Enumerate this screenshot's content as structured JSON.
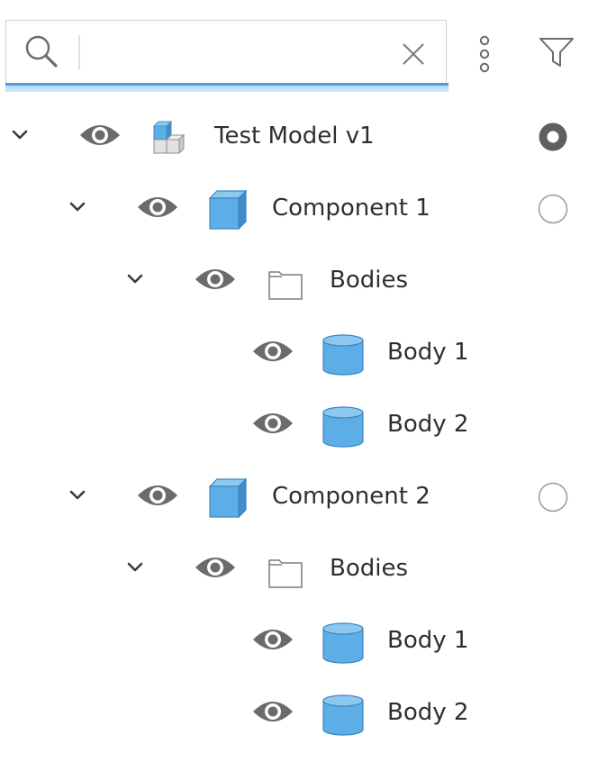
{
  "search": {
    "value": "",
    "placeholder": ""
  },
  "colors": {
    "accent": "#4d9bd8",
    "icon_blue": "#5daee6",
    "icon_gray": "#6b6b6b"
  },
  "toolbar_icons": [
    "search-icon",
    "close-icon",
    "more-vertical-icon",
    "filter-icon"
  ],
  "tree": [
    {
      "label": "Test Model v1",
      "type": "model",
      "icon": "assembly-icon",
      "level": 0,
      "expanded": true,
      "visible": true,
      "activation": "active"
    },
    {
      "label": "Component 1",
      "type": "component",
      "icon": "component-cube-icon",
      "level": 1,
      "expanded": true,
      "visible": true,
      "activation": "inactive"
    },
    {
      "label": "Bodies",
      "type": "folder",
      "icon": "folder-icon",
      "level": 2,
      "expanded": true,
      "visible": true,
      "activation": "none"
    },
    {
      "label": "Body 1",
      "type": "body",
      "icon": "body-cylinder-icon",
      "level": 3,
      "expanded": false,
      "visible": true,
      "activation": "none"
    },
    {
      "label": "Body 2",
      "type": "body",
      "icon": "body-cylinder-icon",
      "level": 3,
      "expanded": false,
      "visible": true,
      "activation": "none"
    },
    {
      "label": "Component 2",
      "type": "component",
      "icon": "component-cube-icon",
      "level": 1,
      "expanded": true,
      "visible": true,
      "activation": "inactive"
    },
    {
      "label": "Bodies",
      "type": "folder",
      "icon": "folder-icon",
      "level": 2,
      "expanded": true,
      "visible": true,
      "activation": "none"
    },
    {
      "label": "Body 1",
      "type": "body",
      "icon": "body-cylinder-icon",
      "level": 3,
      "expanded": false,
      "visible": true,
      "activation": "none"
    },
    {
      "label": "Body 2",
      "type": "body",
      "icon": "body-cylinder-icon",
      "level": 3,
      "expanded": false,
      "visible": true,
      "activation": "none"
    }
  ]
}
